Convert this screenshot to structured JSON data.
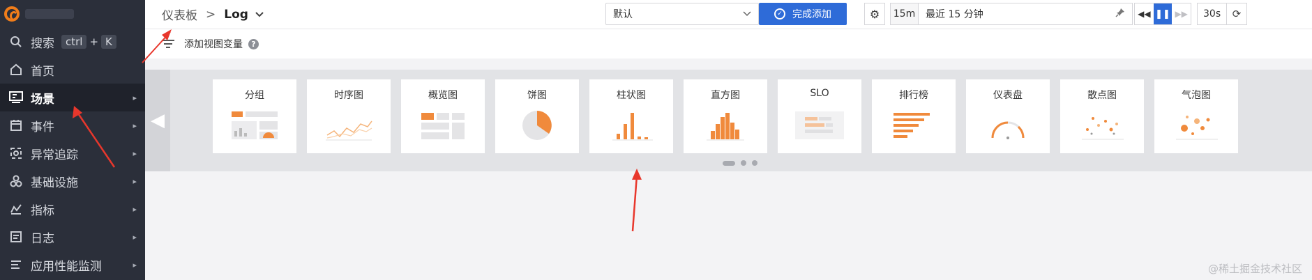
{
  "sidebar": {
    "search": {
      "label": "搜索",
      "kbd": "ctrl",
      "plus": "+",
      "key": "K"
    },
    "items": [
      {
        "label": "首页",
        "icon": "home-icon",
        "has_arrow": false,
        "active": false
      },
      {
        "label": "场景",
        "icon": "scene-icon",
        "has_arrow": true,
        "active": true
      },
      {
        "label": "事件",
        "icon": "calendar-icon",
        "has_arrow": true,
        "active": false
      },
      {
        "label": "异常追踪",
        "icon": "target-icon",
        "has_arrow": true,
        "active": false
      },
      {
        "label": "基础设施",
        "icon": "infrastructure-icon",
        "has_arrow": true,
        "active": false
      },
      {
        "label": "指标",
        "icon": "metrics-icon",
        "has_arrow": true,
        "active": false
      },
      {
        "label": "日志",
        "icon": "log-icon",
        "has_arrow": true,
        "active": false
      },
      {
        "label": "应用性能监测",
        "icon": "apm-icon",
        "has_arrow": true,
        "active": false
      }
    ]
  },
  "header": {
    "breadcrumb_root": "仪表板",
    "breadcrumb_sep": ">",
    "breadcrumb_current": "Log",
    "select_value": "默认",
    "primary_button": "完成添加",
    "time_duration": "15m",
    "time_range": "最近 15 分钟",
    "refresh_interval": "30s"
  },
  "varbar": {
    "label": "添加视图变量",
    "help": "?"
  },
  "picker": {
    "cards": [
      {
        "name": "分组",
        "thumb": "group"
      },
      {
        "name": "时序图",
        "thumb": "line"
      },
      {
        "name": "概览图",
        "thumb": "overview"
      },
      {
        "name": "饼图",
        "thumb": "pie"
      },
      {
        "name": "柱状图",
        "thumb": "bar"
      },
      {
        "name": "直方图",
        "thumb": "histogram"
      },
      {
        "name": "SLO",
        "thumb": "slo"
      },
      {
        "name": "排行榜",
        "thumb": "toplist"
      },
      {
        "name": "仪表盘",
        "thumb": "gauge"
      },
      {
        "name": "散点图",
        "thumb": "scatter"
      },
      {
        "name": "气泡图",
        "thumb": "bubble"
      }
    ]
  },
  "colors": {
    "accent": "#2e6bd8",
    "chart_orange": "#f07d1a",
    "sidebar_bg": "#2b2f3a",
    "annotation_red": "#e8372c"
  },
  "watermark": "@稀土掘金技术社区"
}
